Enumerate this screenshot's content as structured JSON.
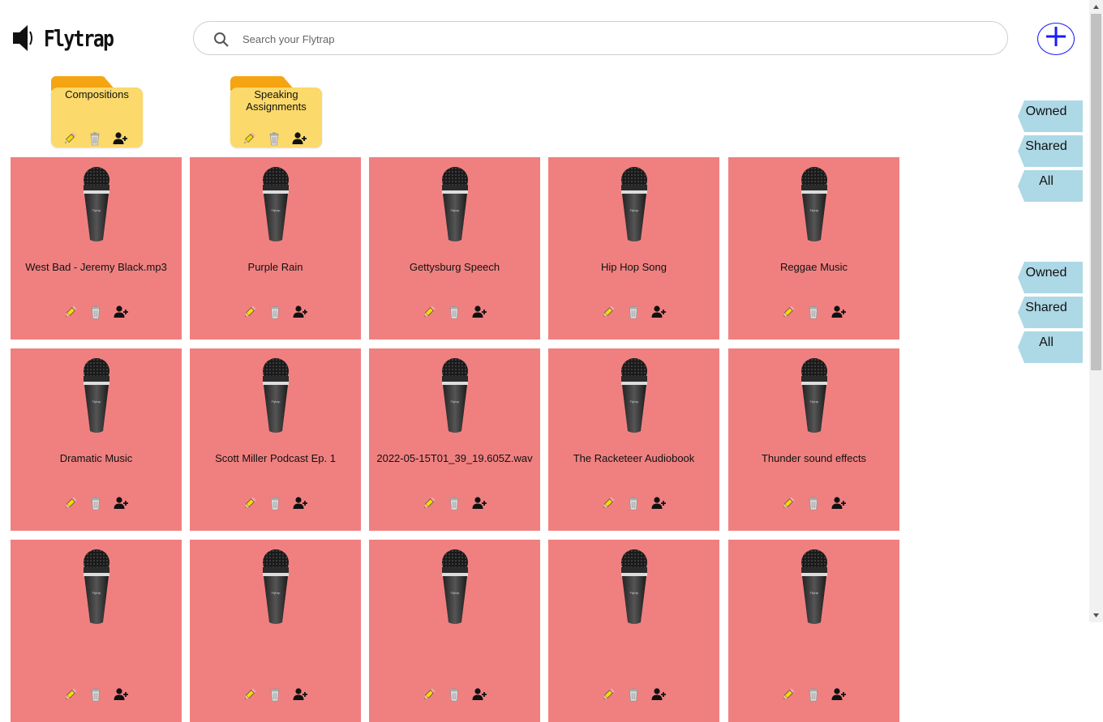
{
  "app": {
    "name": "Flytrap"
  },
  "search": {
    "placeholder": "Search your Flytrap"
  },
  "folders": [
    {
      "name": "Compositions"
    },
    {
      "name": "Speaking Assignments"
    }
  ],
  "cards": [
    {
      "title": "West Bad - Jeremy Black.mp3"
    },
    {
      "title": "Purple Rain"
    },
    {
      "title": "Gettysburg Speech"
    },
    {
      "title": "Hip Hop Song"
    },
    {
      "title": "Reggae Music"
    },
    {
      "title": "Dramatic Music"
    },
    {
      "title": "Scott Miller Podcast Ep. 1"
    },
    {
      "title": "2022-05-15T01_39_19.605Z.wav"
    },
    {
      "title": "The Racketeer Audiobook"
    },
    {
      "title": "Thunder sound effects"
    },
    {
      "title": ""
    },
    {
      "title": ""
    },
    {
      "title": ""
    },
    {
      "title": ""
    },
    {
      "title": ""
    }
  ],
  "filters_top": [
    {
      "label": "Owned"
    },
    {
      "label": "Shared"
    },
    {
      "label": "All"
    }
  ],
  "filters_bottom": [
    {
      "label": "Owned"
    },
    {
      "label": "Shared"
    },
    {
      "label": "All"
    }
  ],
  "icons": {
    "logo": "speaker-icon",
    "search": "search-icon",
    "add": "plus-icon",
    "edit": "pencil-icon",
    "delete": "trash-icon",
    "share": "add-user-icon",
    "card": "microphone-icon"
  },
  "colors": {
    "card": "#f08080",
    "folder": "#fbd96a",
    "folder_tab": "#f5a412",
    "filter_tab": "#add8e6",
    "add_button": "#1a1aff"
  }
}
